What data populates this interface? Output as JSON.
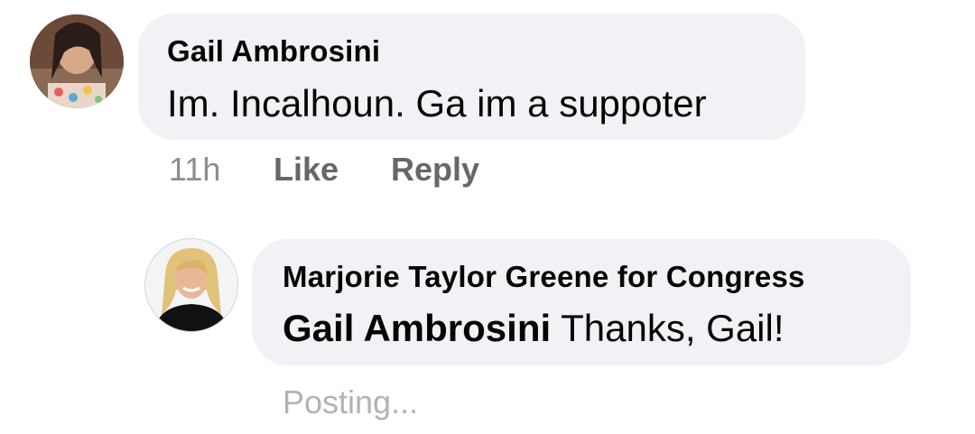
{
  "comment": {
    "author": "Gail Ambrosini",
    "text": "Im.  Incalhoun.  Ga im a suppoter",
    "time": "11h",
    "like_label": "Like",
    "reply_label": "Reply"
  },
  "reply": {
    "author": "Marjorie Taylor Greene for Congress",
    "mention": "Gail Ambrosini",
    "text": " Thanks, Gail!",
    "status": "Posting..."
  },
  "colors": {
    "bubble": "#f0f2f5",
    "text": "#050505",
    "meta": "#65676b",
    "muted": "#b0b3b8"
  }
}
